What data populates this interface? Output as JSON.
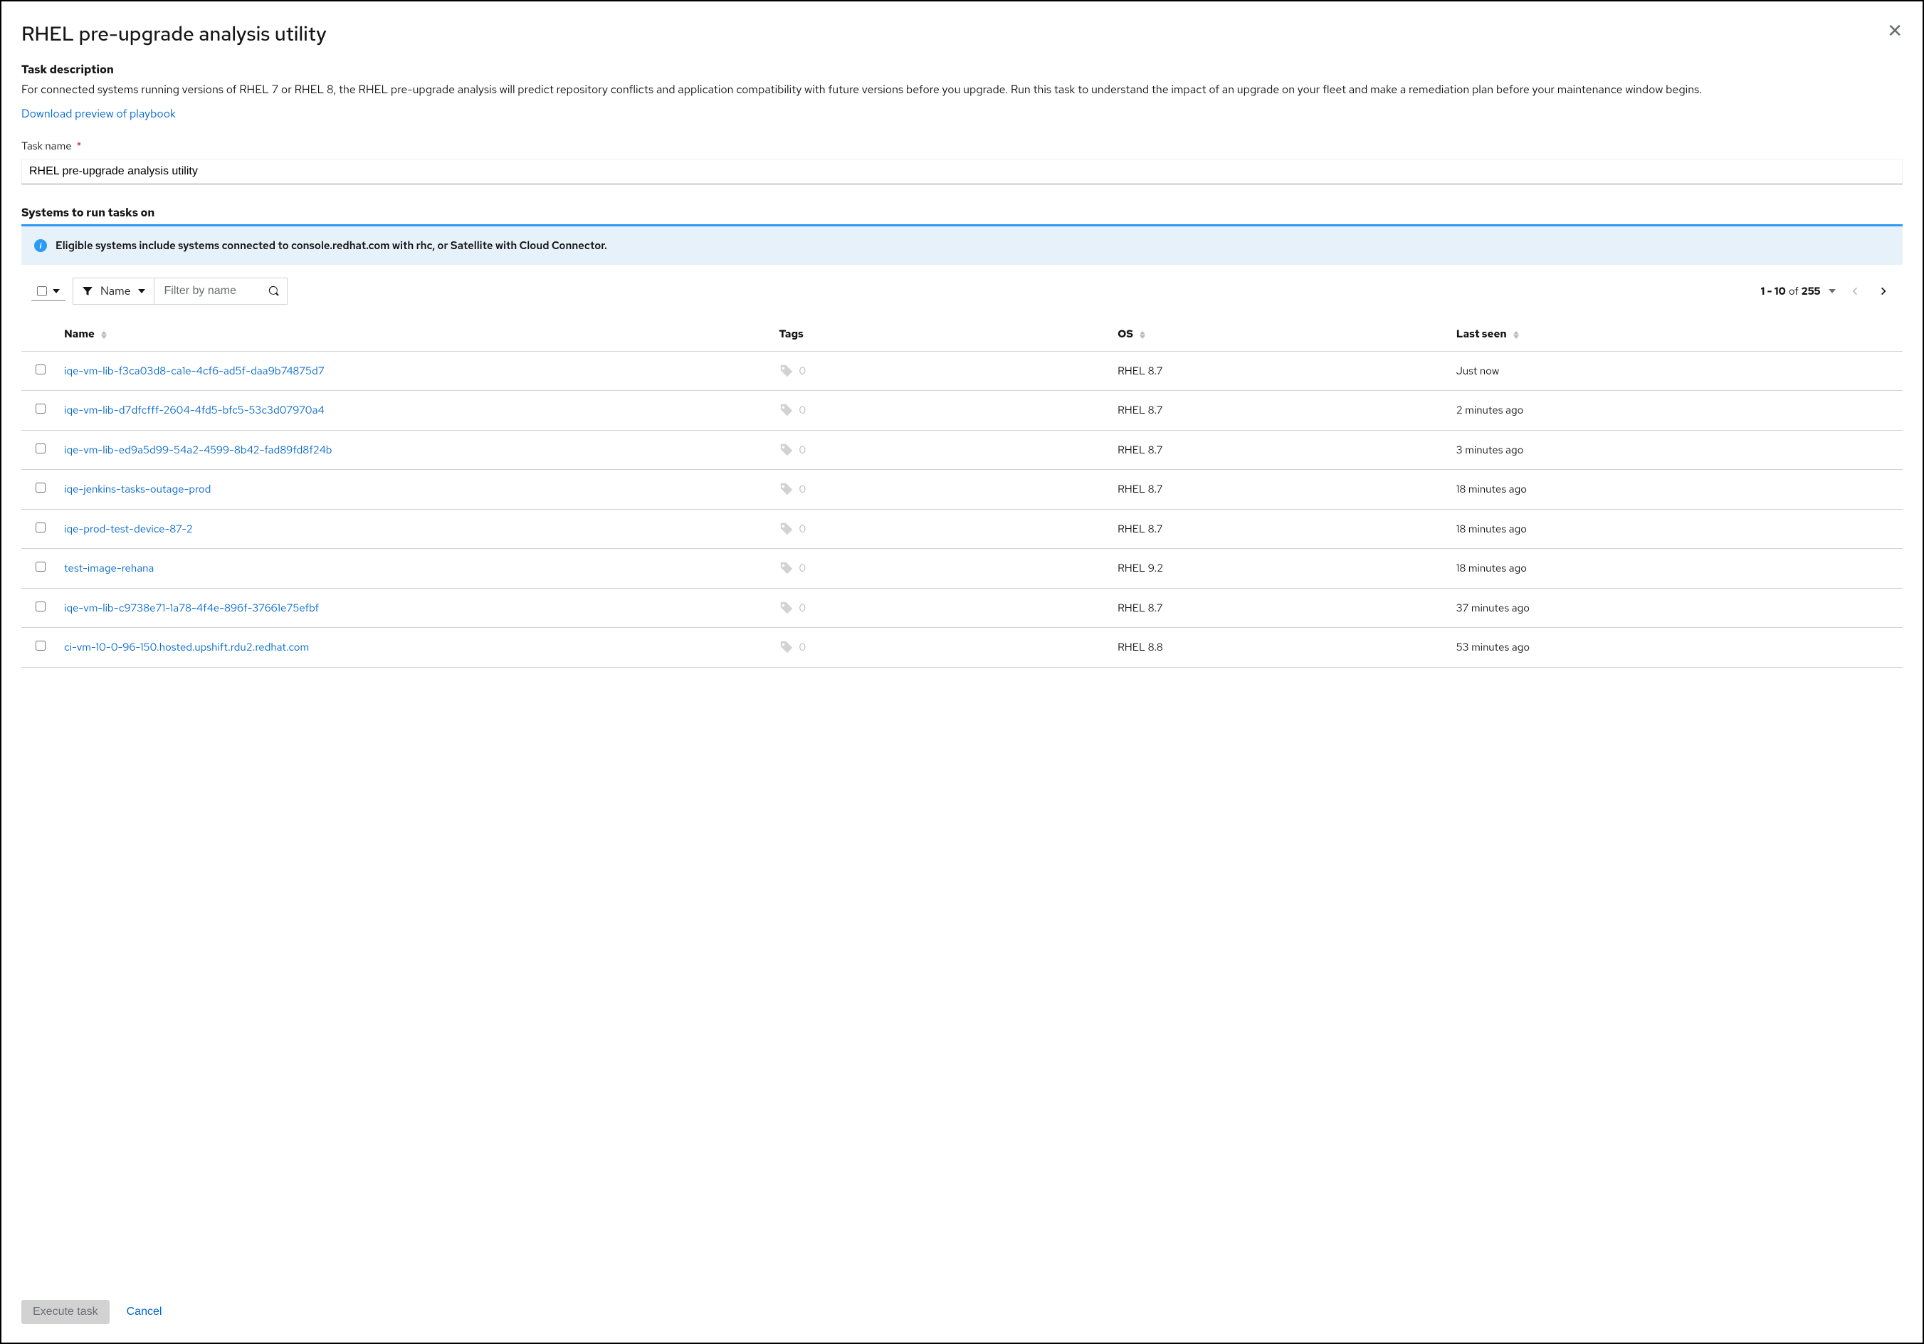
{
  "modal": {
    "title": "RHEL pre-upgrade analysis utility",
    "description_label": "Task description",
    "description_text": "For connected systems running versions of RHEL 7 or RHEL 8, the RHEL pre-upgrade analysis will predict repository conflicts and application compatibility with future versions before you upgrade. Run this task to understand the impact of an upgrade on your fleet and make a remediation plan before your maintenance window begins.",
    "download_link": "Download preview of playbook",
    "task_name_label": "Task name",
    "task_name_value": "RHEL pre-upgrade analysis utility",
    "required_mark": "*",
    "systems_heading": "Systems to run tasks on",
    "alert_text": "Eligible systems include systems connected to console.redhat.com with rhc, or Satellite with Cloud Connector.",
    "info_glyph": "i"
  },
  "toolbar": {
    "filter_type_label": "Name",
    "filter_placeholder": "Filter by name"
  },
  "pagination": {
    "range": "1 - 10",
    "of_word": "of",
    "total": "255"
  },
  "columns": {
    "name": "Name",
    "tags": "Tags",
    "os": "OS",
    "last_seen": "Last seen"
  },
  "rows": [
    {
      "name": "iqe-vm-lib-f3ca03d8-ca1e-4cf6-ad5f-daa9b74875d7",
      "tags": "0",
      "os": "RHEL 8.7",
      "last_seen": "Just now"
    },
    {
      "name": "iqe-vm-lib-d7dfcfff-2604-4fd5-bfc5-53c3d07970a4",
      "tags": "0",
      "os": "RHEL 8.7",
      "last_seen": "2 minutes ago"
    },
    {
      "name": "iqe-vm-lib-ed9a5d99-54a2-4599-8b42-fad89fd8f24b",
      "tags": "0",
      "os": "RHEL 8.7",
      "last_seen": "3 minutes ago"
    },
    {
      "name": "iqe-jenkins-tasks-outage-prod",
      "tags": "0",
      "os": "RHEL 8.7",
      "last_seen": "18 minutes ago"
    },
    {
      "name": "iqe-prod-test-device-87-2",
      "tags": "0",
      "os": "RHEL 8.7",
      "last_seen": "18 minutes ago"
    },
    {
      "name": "test-image-rehana",
      "tags": "0",
      "os": "RHEL 9.2",
      "last_seen": "18 minutes ago"
    },
    {
      "name": "iqe-vm-lib-c9738e71-1a78-4f4e-896f-37661e75efbf",
      "tags": "0",
      "os": "RHEL 8.7",
      "last_seen": "37 minutes ago"
    },
    {
      "name": "ci-vm-10-0-96-150.hosted.upshift.rdu2.redhat.com",
      "tags": "0",
      "os": "RHEL 8.8",
      "last_seen": "53 minutes ago"
    }
  ],
  "footer": {
    "execute_label": "Execute task",
    "cancel_label": "Cancel"
  }
}
